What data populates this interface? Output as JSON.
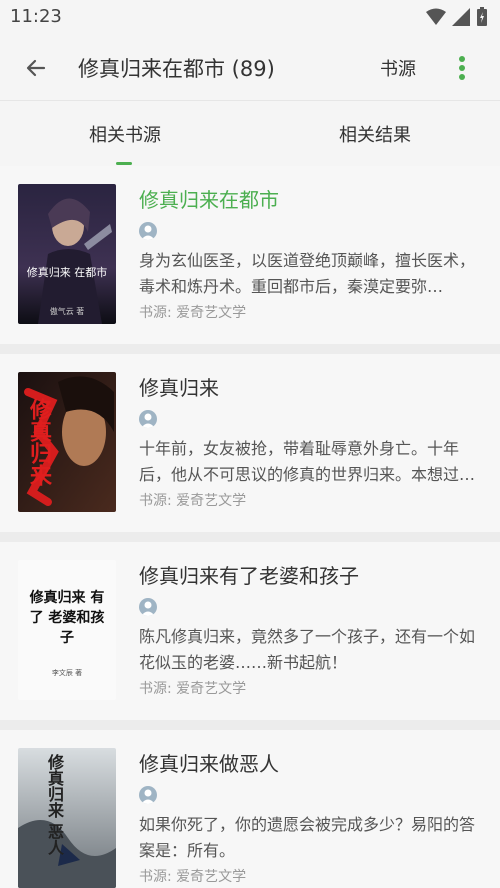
{
  "status": {
    "time": "11:23"
  },
  "header": {
    "title": "修真归来在都市 (89)",
    "source_label": "书源"
  },
  "tabs": [
    "相关书源",
    "相关结果"
  ],
  "books": [
    {
      "title": "修真归来在都市",
      "desc": "身为玄仙医圣，以医道登绝顶巅峰，擅长医术，毒术和炼丹术。重回都市后，秦漠定要弥…",
      "source": "书源: 爱奇艺文学",
      "cover_text": "修真归来 在都市",
      "cover_author": "傲气云 著"
    },
    {
      "title": "修真归来",
      "desc": "十年前，女友被抢，带着耻辱意外身亡。十年后，他从不可思议的修真的世界归来。本想过…",
      "source": "书源: 爱奇艺文学",
      "cover_text": "修真归来"
    },
    {
      "title": "修真归来有了老婆和孩子",
      "desc": "陈凡修真归来，竟然多了一个孩子，还有一个如花似玉的老婆……新书起航！",
      "source": "书源: 爱奇艺文学",
      "cover_text": "修真归来 有了 老婆和孩子",
      "cover_author": "李文辰 著"
    },
    {
      "title": "修真归来做恶人",
      "desc": "如果你死了，你的遗愿会被完成多少？易阳的答案是：所有。",
      "source": "书源: 爱奇艺文学",
      "cover_text": "修真归来 恶人"
    }
  ],
  "colors": {
    "accent": "#4caf50"
  }
}
